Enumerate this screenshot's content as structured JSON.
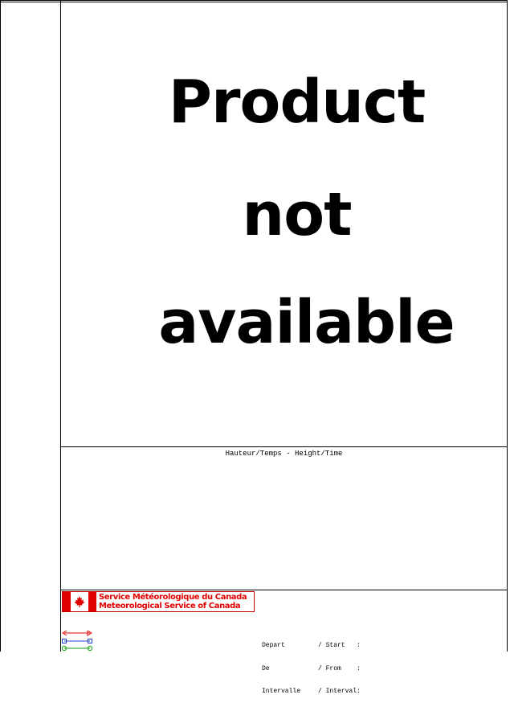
{
  "notice": {
    "line1": "Product",
    "line2": "not",
    "line3": "available"
  },
  "chart": {
    "title": "Hauteur/Temps - Height/Time"
  },
  "logo": {
    "fr": "Service Météorologique du Canada",
    "en": "Meteorological Service of Canada",
    "icon": "maple-leaf-flag-icon"
  },
  "info": {
    "rows": [
      {
        "fr": "Depart",
        "en": "/ Start",
        "sep": ":"
      },
      {
        "fr": "De",
        "en": "/ From",
        "sep": ":"
      },
      {
        "fr": "Intervalle",
        "en": "/ Interval",
        "sep": ":"
      }
    ]
  },
  "colors": {
    "brand_red": "#e00000",
    "legend_red": "#e00000",
    "legend_blue": "#2040d0",
    "legend_green": "#10a010"
  }
}
